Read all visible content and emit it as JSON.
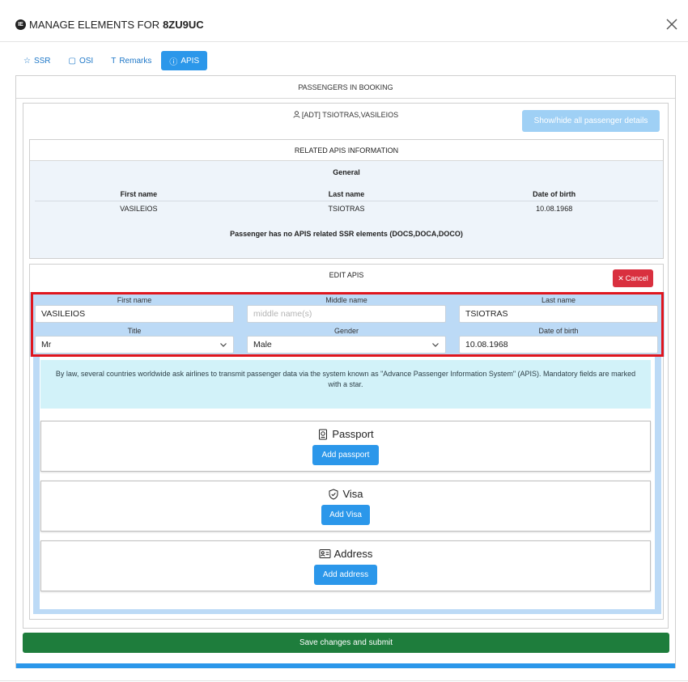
{
  "modal": {
    "title_prefix": "MANAGE ELEMENTS FOR",
    "booking_ref": "8ZU9UC",
    "title_icon_text": "IE"
  },
  "tabs": [
    {
      "label": "SSR",
      "icon": "star-icon",
      "active": false
    },
    {
      "label": "OSI",
      "icon": "note-icon",
      "active": false
    },
    {
      "label": "Remarks",
      "icon": "text-icon",
      "active": false
    },
    {
      "label": "APIS",
      "icon": "info-icon",
      "active": true
    }
  ],
  "passengers": {
    "header": "PASSENGERS IN BOOKING",
    "passenger_label": "[ADT] TSIOTRAS,VASILEIOS",
    "show_hide_label": "Show/hide all passenger details"
  },
  "related": {
    "header": "RELATED APIS INFORMATION",
    "section": "General",
    "columns": [
      "First name",
      "Last name",
      "Date of birth"
    ],
    "row": [
      "VASILEIOS",
      "TSIOTRAS",
      "10.08.1968"
    ],
    "no_apis_message": "Passenger has no APIS related SSR elements (DOCS,DOCA,DOCO)"
  },
  "edit": {
    "header": "EDIT APIS",
    "cancel_label": "Cancel",
    "first_name_label": "First name",
    "first_name_value": "VASILEIOS",
    "middle_name_label": "Middle name",
    "middle_name_placeholder": "middle name(s)",
    "last_name_label": "Last name",
    "last_name_value": "TSIOTRAS",
    "title_label": "Title",
    "title_value": "Mr",
    "gender_label": "Gender",
    "gender_value": "Male",
    "dob_label": "Date of birth",
    "dob_value": "10.08.1968",
    "info_text": "By law, several countries worldwide ask airlines to transmit passenger data via the system known as \"Advance Passenger Information System\" (APIS). Mandatory fields are marked with a star.",
    "passport_title": "Passport",
    "passport_button": "Add passport",
    "visa_title": "Visa",
    "visa_button": "Add Visa",
    "address_title": "Address",
    "address_button": "Add address"
  },
  "footer": {
    "save_label": "Save changes and submit"
  },
  "colors": {
    "primary": "#2b97ea",
    "danger": "#d9303f",
    "success": "#1e7d3c",
    "highlight": "#e0161e"
  }
}
